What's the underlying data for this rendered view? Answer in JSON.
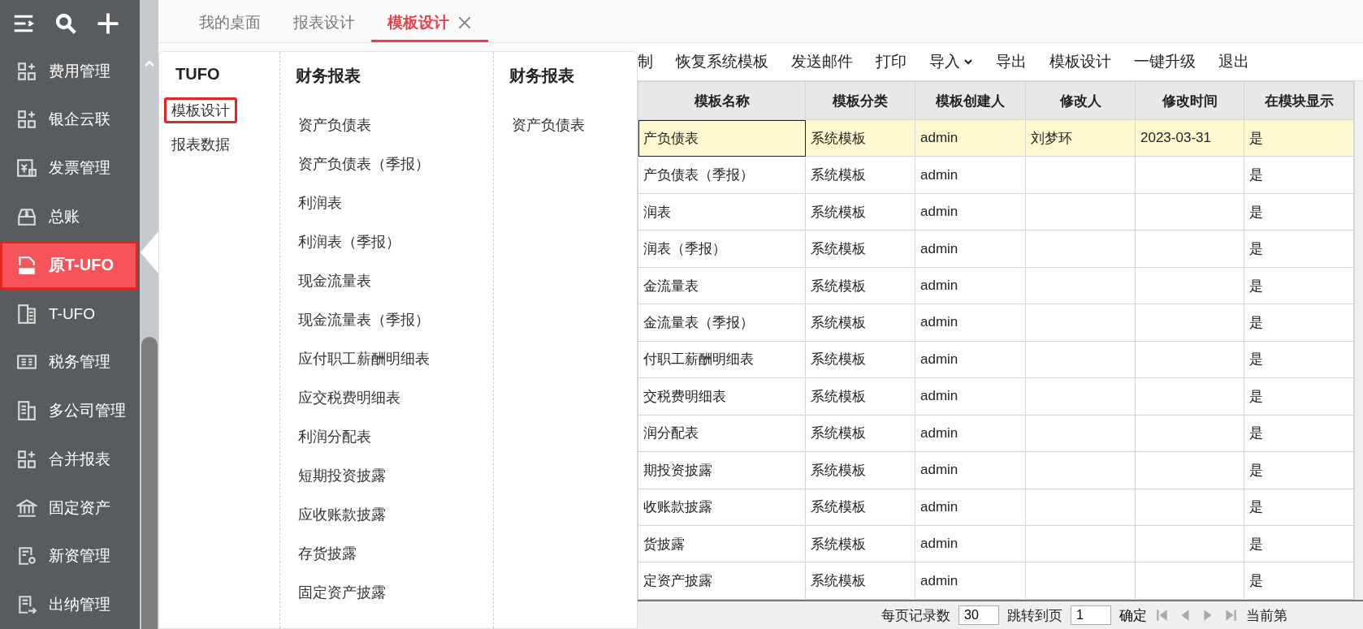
{
  "sidebar": {
    "items": [
      {
        "label": "费用管理",
        "selected": false
      },
      {
        "label": "银企云联",
        "selected": false
      },
      {
        "label": "发票管理",
        "selected": false
      },
      {
        "label": "总账",
        "selected": false
      },
      {
        "label": "原T-UFO",
        "selected": true
      },
      {
        "label": "T-UFO",
        "selected": false
      },
      {
        "label": "税务管理",
        "selected": false
      },
      {
        "label": "多公司管理",
        "selected": false
      },
      {
        "label": "合并报表",
        "selected": false
      },
      {
        "label": "固定资产",
        "selected": false
      },
      {
        "label": "新资管理",
        "selected": false
      },
      {
        "label": "出纳管理",
        "selected": false
      }
    ]
  },
  "tabs": [
    {
      "label": "我的桌面",
      "selected": false,
      "closable": false
    },
    {
      "label": "报表设计",
      "selected": false,
      "closable": false
    },
    {
      "label": "模板设计",
      "selected": true,
      "closable": true
    }
  ],
  "dropdown": {
    "columns": [
      {
        "title": "TUFO",
        "items": [
          {
            "label": "模板设计",
            "selected": true
          },
          {
            "label": "报表数据",
            "selected": false
          }
        ]
      },
      {
        "title": "财务报表",
        "items": [
          {
            "label": "资产负债表",
            "selected": false
          },
          {
            "label": "资产负债表（季报）",
            "selected": false
          },
          {
            "label": "利润表",
            "selected": false
          },
          {
            "label": "利润表（季报）",
            "selected": false
          },
          {
            "label": "现金流量表",
            "selected": false
          },
          {
            "label": "现金流量表（季报）",
            "selected": false
          },
          {
            "label": "应付职工薪酬明细表",
            "selected": false
          },
          {
            "label": "应交税费明细表",
            "selected": false
          },
          {
            "label": "利润分配表",
            "selected": false
          },
          {
            "label": "短期投资披露",
            "selected": false
          },
          {
            "label": "应收账款披露",
            "selected": false
          },
          {
            "label": "存货披露",
            "selected": false
          },
          {
            "label": "固定资产披露",
            "selected": false
          }
        ]
      },
      {
        "title": "财务报表",
        "items": [
          {
            "label": "资产负债表",
            "selected": false
          }
        ]
      }
    ]
  },
  "toolbar": {
    "items": [
      {
        "label": "制",
        "dropdown": false
      },
      {
        "label": "恢复系统模板",
        "dropdown": false
      },
      {
        "label": "发送邮件",
        "dropdown": false
      },
      {
        "label": "打印",
        "dropdown": false
      },
      {
        "label": "导入",
        "dropdown": true
      },
      {
        "label": "导出",
        "dropdown": false
      },
      {
        "label": "模板设计",
        "dropdown": false
      },
      {
        "label": "一键升级",
        "dropdown": false
      },
      {
        "label": "退出",
        "dropdown": false
      }
    ]
  },
  "table": {
    "columns": [
      "模板名称",
      "模板分类",
      "模板创建人",
      "修改人",
      "修改时间",
      "在模块显示"
    ],
    "rows": [
      {
        "selected": true,
        "cells": [
          "产负债表",
          "系统模板",
          "admin",
          "刘梦环",
          "2023-03-31",
          "是"
        ]
      },
      {
        "selected": false,
        "cells": [
          "产负债表（季报）",
          "系统模板",
          "admin",
          "",
          "",
          "是"
        ]
      },
      {
        "selected": false,
        "cells": [
          "润表",
          "系统模板",
          "admin",
          "",
          "",
          "是"
        ]
      },
      {
        "selected": false,
        "cells": [
          "润表（季报）",
          "系统模板",
          "admin",
          "",
          "",
          "是"
        ]
      },
      {
        "selected": false,
        "cells": [
          "金流量表",
          "系统模板",
          "admin",
          "",
          "",
          "是"
        ]
      },
      {
        "selected": false,
        "cells": [
          "金流量表（季报）",
          "系统模板",
          "admin",
          "",
          "",
          "是"
        ]
      },
      {
        "selected": false,
        "cells": [
          "付职工薪酬明细表",
          "系统模板",
          "admin",
          "",
          "",
          "是"
        ]
      },
      {
        "selected": false,
        "cells": [
          "交税费明细表",
          "系统模板",
          "admin",
          "",
          "",
          "是"
        ]
      },
      {
        "selected": false,
        "cells": [
          "润分配表",
          "系统模板",
          "admin",
          "",
          "",
          "是"
        ]
      },
      {
        "selected": false,
        "cells": [
          "期投资披露",
          "系统模板",
          "admin",
          "",
          "",
          "是"
        ]
      },
      {
        "selected": false,
        "cells": [
          "收账款披露",
          "系统模板",
          "admin",
          "",
          "",
          "是"
        ]
      },
      {
        "selected": false,
        "cells": [
          "货披露",
          "系统模板",
          "admin",
          "",
          "",
          "是"
        ]
      },
      {
        "selected": false,
        "cells": [
          "定资产披露",
          "系统模板",
          "admin",
          "",
          "",
          "是"
        ]
      }
    ]
  },
  "footer": {
    "page_size_label": "每页记录数",
    "page_size": "30",
    "jump_label": "跳转到页",
    "page": "1",
    "confirm": "确定",
    "current_label": "当前第"
  }
}
